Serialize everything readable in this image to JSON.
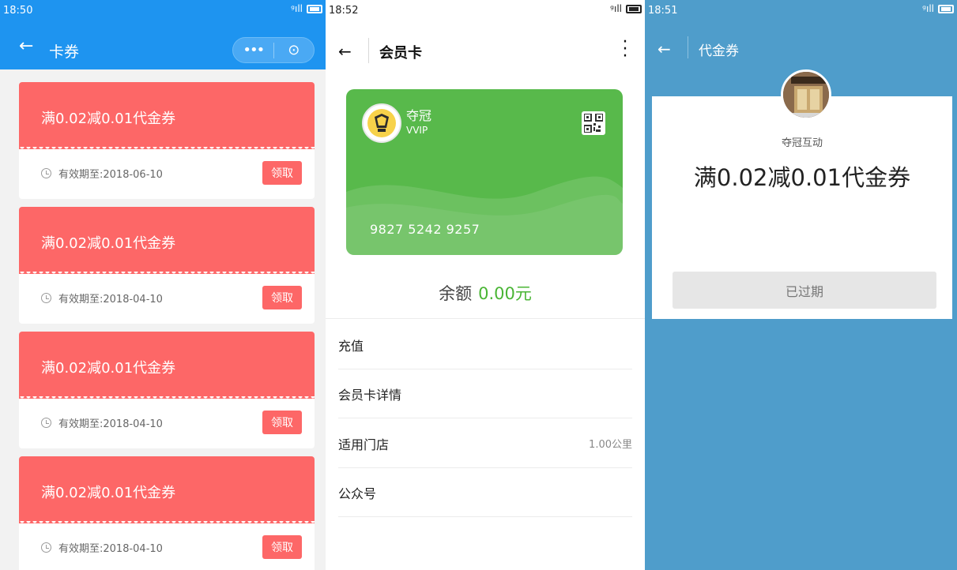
{
  "screen1": {
    "time": "18:50",
    "signal": "ᵍıll",
    "title": "卡券",
    "capsule_more": "•••",
    "capsule_target": "⊙",
    "coupons": [
      {
        "title": "满0.02减0.01代金券",
        "expiry": "有效期至:2018-06-10",
        "action": "领取"
      },
      {
        "title": "满0.02减0.01代金券",
        "expiry": "有效期至:2018-04-10",
        "action": "领取"
      },
      {
        "title": "满0.02减0.01代金券",
        "expiry": "有效期至:2018-04-10",
        "action": "领取"
      },
      {
        "title": "满0.02减0.01代金券",
        "expiry": "有效期至:2018-04-10",
        "action": "领取"
      }
    ]
  },
  "screen2": {
    "time": "18:52",
    "signal": "ᵍıll",
    "title": "会员卡",
    "card": {
      "name": "夺冠",
      "level": "VVIP",
      "number": "9827 5242 9257",
      "color": "#58b94b"
    },
    "balance_label": "余额",
    "balance_value": "0.00元",
    "menu": [
      {
        "label": "充值",
        "value": ""
      },
      {
        "label": "会员卡详情",
        "value": ""
      },
      {
        "label": "适用门店",
        "value": "1.00公里"
      },
      {
        "label": "公众号",
        "value": ""
      }
    ]
  },
  "screen3": {
    "time": "18:51",
    "signal": "ᵍıll",
    "title": "代金券",
    "merchant": "夺冠互动",
    "voucher_title": "满0.02减0.01代金券",
    "status_button": "已过期"
  },
  "colors": {
    "primary_blue": "#1e94f0",
    "coupon_red": "#fd6767",
    "card_green": "#58b94b",
    "amount_green": "#49b534",
    "page_blue": "#4f9dcb"
  }
}
